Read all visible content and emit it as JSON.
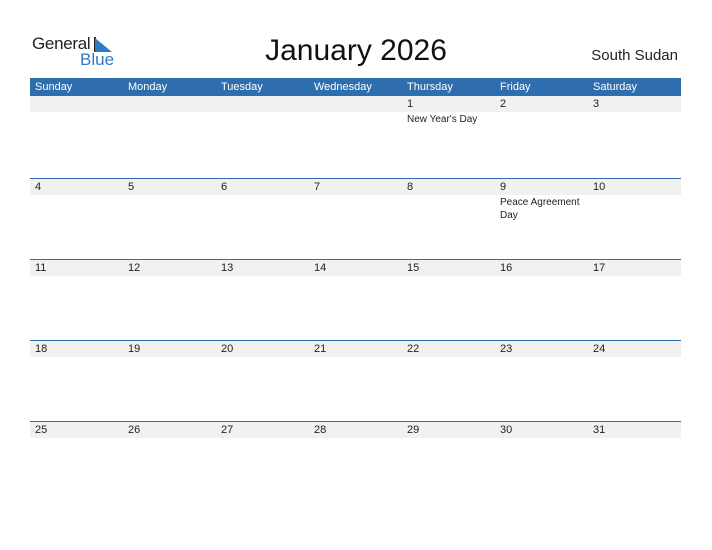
{
  "logo": {
    "general": "General",
    "blue": "Blue"
  },
  "title": "January 2026",
  "country": "South Sudan",
  "colors": {
    "header_bg": "#2f6eae",
    "accent": "#2c7bc4",
    "strip_bg": "#f1f1f1"
  },
  "weekdays": [
    "Sunday",
    "Monday",
    "Tuesday",
    "Wednesday",
    "Thursday",
    "Friday",
    "Saturday"
  ],
  "weeks": [
    [
      {
        "n": ""
      },
      {
        "n": ""
      },
      {
        "n": ""
      },
      {
        "n": ""
      },
      {
        "n": "1",
        "ev": "New Year's Day"
      },
      {
        "n": "2"
      },
      {
        "n": "3"
      }
    ],
    [
      {
        "n": "4"
      },
      {
        "n": "5"
      },
      {
        "n": "6"
      },
      {
        "n": "7"
      },
      {
        "n": "8"
      },
      {
        "n": "9",
        "ev": "Peace Agreement Day"
      },
      {
        "n": "10"
      }
    ],
    [
      {
        "n": "11"
      },
      {
        "n": "12"
      },
      {
        "n": "13"
      },
      {
        "n": "14"
      },
      {
        "n": "15"
      },
      {
        "n": "16"
      },
      {
        "n": "17"
      }
    ],
    [
      {
        "n": "18"
      },
      {
        "n": "19"
      },
      {
        "n": "20"
      },
      {
        "n": "21"
      },
      {
        "n": "22"
      },
      {
        "n": "23"
      },
      {
        "n": "24"
      }
    ],
    [
      {
        "n": "25"
      },
      {
        "n": "26"
      },
      {
        "n": "27"
      },
      {
        "n": "28"
      },
      {
        "n": "29"
      },
      {
        "n": "30"
      },
      {
        "n": "31"
      }
    ]
  ]
}
